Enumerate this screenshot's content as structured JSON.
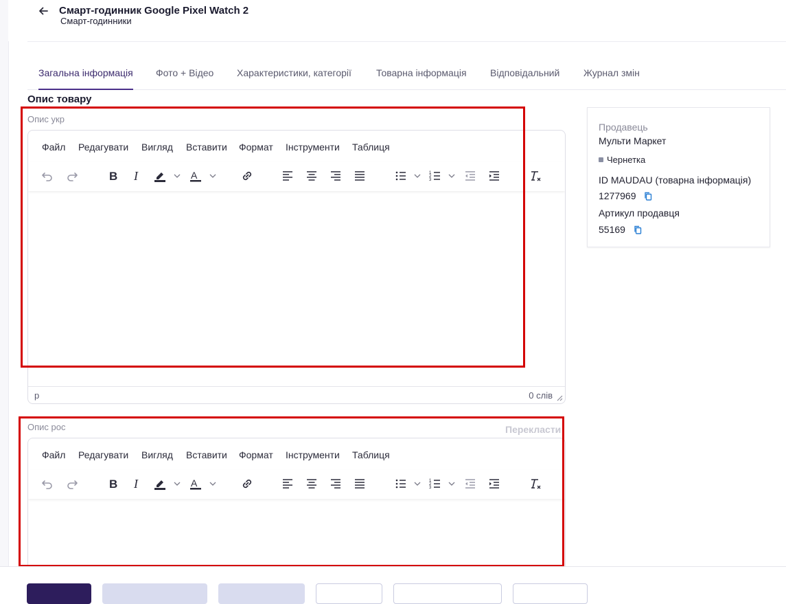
{
  "header": {
    "title": "Смарт-годинник Google Pixel Watch 2",
    "subtitle": "Смарт-годинники"
  },
  "tabs": [
    {
      "label": "Загальна інформація",
      "active": true
    },
    {
      "label": "Фото + Відео",
      "active": false
    },
    {
      "label": "Характеристики, категорії",
      "active": false
    },
    {
      "label": "Товарна інформація",
      "active": false
    },
    {
      "label": "Відповідальний",
      "active": false
    },
    {
      "label": "Журнал змін",
      "active": false
    }
  ],
  "section_title": "Опис товару",
  "editor_ukr": {
    "label": "Опис укр",
    "menu": [
      "Файл",
      "Редагувати",
      "Вигляд",
      "Вставити",
      "Формат",
      "Інструменти",
      "Таблиця"
    ],
    "status_path": "p",
    "word_count": "0 слів"
  },
  "editor_ros": {
    "label": "Опис рос",
    "translate_label": "Перекласти",
    "menu": [
      "Файл",
      "Редагувати",
      "Вигляд",
      "Вставити",
      "Формат",
      "Інструменти",
      "Таблиця"
    ]
  },
  "toolbar_icons": [
    "undo-icon",
    "redo-icon",
    "bold-icon",
    "italic-icon",
    "highlight-color-icon",
    "text-color-icon",
    "link-icon",
    "align-left-icon",
    "align-center-icon",
    "align-right-icon",
    "align-justify-icon",
    "bullet-list-icon",
    "numbered-list-icon",
    "outdent-icon",
    "indent-icon",
    "clear-format-icon"
  ],
  "side_card": {
    "seller_label": "Продавець",
    "seller_value": "Мульти Маркет",
    "status": "Чернетка",
    "maudau_id_label": "ID MAUDAU (товарна інформація)",
    "maudau_id_value": "1277969",
    "sku_label": "Артикул продавця",
    "sku_value": "55169"
  },
  "colors": {
    "accent": "#2d1d5c",
    "highlight_box": "#d40000",
    "tab_active": "#4a2f8a"
  }
}
